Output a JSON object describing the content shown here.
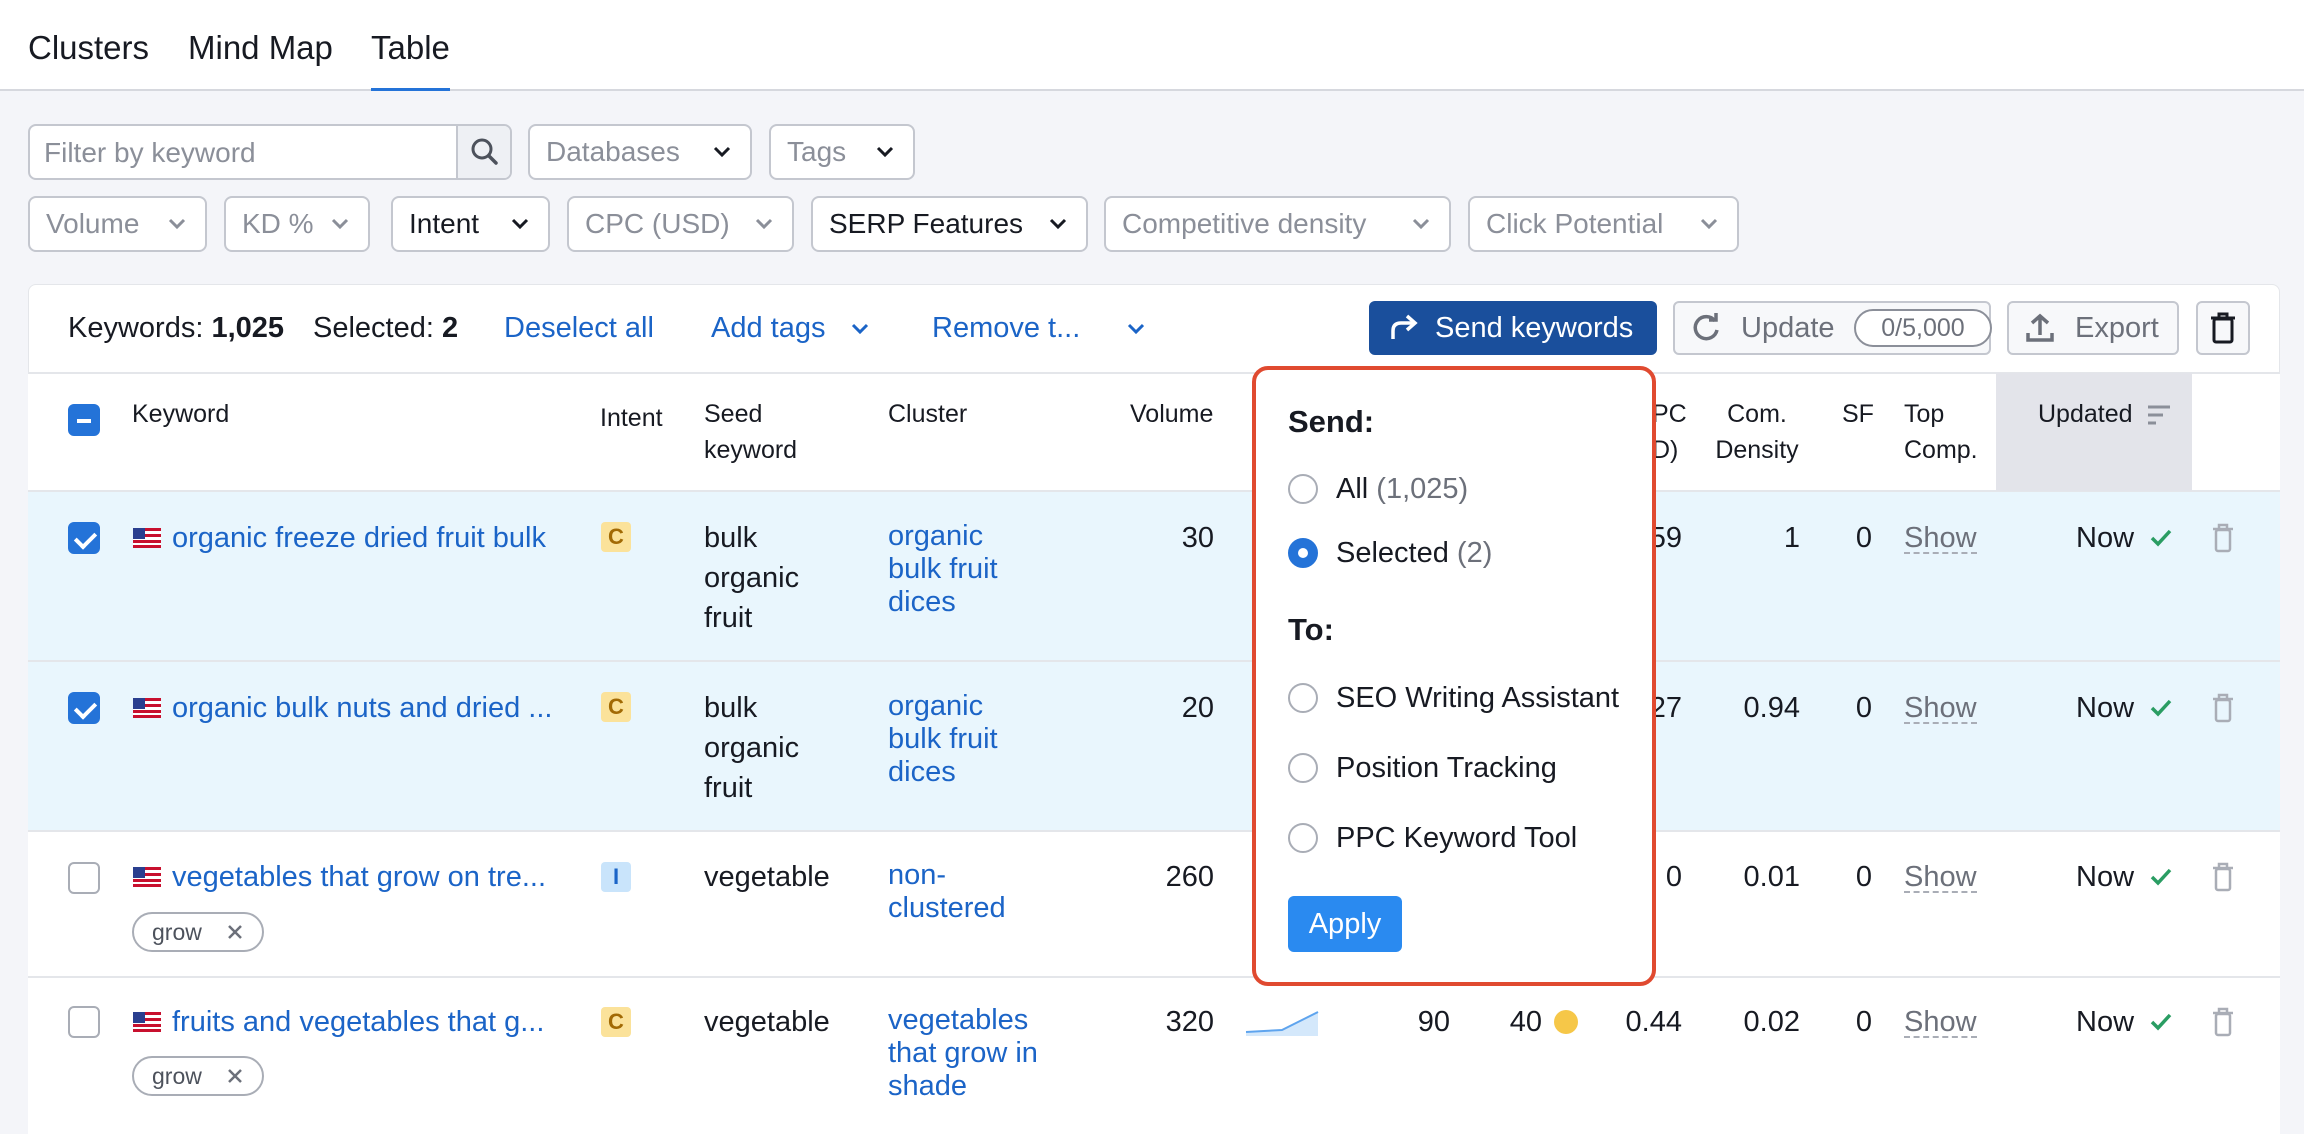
{
  "tabs": [
    {
      "label": "Clusters",
      "active": false
    },
    {
      "label": "Mind Map",
      "active": false
    },
    {
      "label": "Table",
      "active": true
    }
  ],
  "filters": {
    "search_placeholder": "Filter by keyword",
    "databases": "Databases",
    "tags": "Tags",
    "volume": "Volume",
    "kd": "KD %",
    "intent": "Intent",
    "cpc": "CPC (USD)",
    "serp": "SERP Features",
    "competitive_density": "Competitive density",
    "click_potential": "Click Potential"
  },
  "toolbar": {
    "keywords_label": "Keywords:",
    "keywords_count": "1,025",
    "selected_label": "Selected:",
    "selected_count": "2",
    "deselect_all": "Deselect all",
    "add_tags": "Add tags",
    "remove_tags": "Remove t...",
    "send_keywords": "Send keywords",
    "update": "Update",
    "update_counter": "0/5,000",
    "export": "Export"
  },
  "columns": {
    "keyword": "Keyword",
    "intent": "Intent",
    "seed_1": "Seed",
    "seed_2": "keyword",
    "cluster": "Cluster",
    "volume": "Volume",
    "cpc_1": "PC",
    "cpc_2": "D)",
    "com_1": "Com.",
    "com_2": "Density",
    "sf": "SF",
    "top_1": "Top",
    "top_2": "Comp.",
    "updated": "Updated"
  },
  "rows": [
    {
      "selected": true,
      "keyword": "organic freeze dried fruit bulk",
      "intent": "C",
      "seed": [
        "bulk",
        "organic",
        "fruit"
      ],
      "cluster": [
        "organic",
        "bulk fruit",
        "dices"
      ],
      "volume": "30",
      "cpc_partial": "59",
      "com_density": "1",
      "sf": "0",
      "top": "Show",
      "updated": "Now"
    },
    {
      "selected": true,
      "keyword": "organic bulk nuts and dried ...",
      "intent": "C",
      "seed": [
        "bulk",
        "organic",
        "fruit"
      ],
      "cluster": [
        "organic",
        "bulk fruit",
        "dices"
      ],
      "volume": "20",
      "cpc_partial": "27",
      "com_density": "0.94",
      "sf": "0",
      "top": "Show",
      "updated": "Now"
    },
    {
      "selected": false,
      "keyword": "vegetables that grow on tre...",
      "intent": "I",
      "seed": [
        "vegetable"
      ],
      "cluster": [
        "non-",
        "clustered"
      ],
      "volume": "260",
      "cpc_partial": "0",
      "com_density": "0.01",
      "sf": "0",
      "top": "Show",
      "updated": "Now",
      "tag": "grow"
    },
    {
      "selected": false,
      "keyword": "fruits and vegetables that g...",
      "intent": "C",
      "seed": [
        "vegetable"
      ],
      "cluster": [
        "vegetables",
        "that grow in",
        "shade"
      ],
      "volume": "320",
      "click_potential": "90",
      "kd": "40",
      "cpc": "0.44",
      "com_density": "0.02",
      "sf": "0",
      "top": "Show",
      "updated": "Now",
      "tag": "grow"
    }
  ],
  "popup": {
    "send_title": "Send:",
    "all_label": "All",
    "all_count": "(1,025)",
    "selected_label": "Selected",
    "selected_count": "(2)",
    "to_title": "To:",
    "targets": [
      "SEO Writing Assistant",
      "Position Tracking",
      "PPC Keyword Tool"
    ],
    "apply": "Apply"
  },
  "colors": {
    "accent": "#2473d8",
    "primary_button": "#1a4f9c",
    "popup_border": "#e04a30",
    "link": "#1b64c7"
  }
}
